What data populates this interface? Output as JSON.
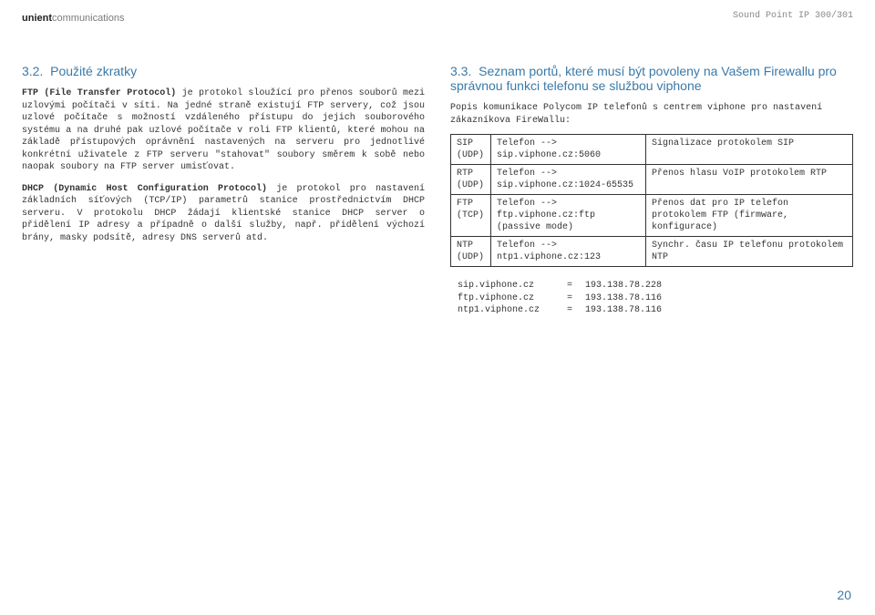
{
  "header": {
    "logo_bold": "unient",
    "logo_light": "communications",
    "device": "Sound Point IP 300/301"
  },
  "left": {
    "h_num": "3.2.",
    "h_text": "Použité zkratky",
    "p1_bold": "FTP (File Transfer Protocol)",
    "p1_rest": " je protokol sloužící pro přenos souborů mezi uzlovými počítači v síti. Na jedné straně existují FTP servery, což jsou uzlové počítače s možností vzdáleného přístupu do jejich souborového systému a na druhé pak uzlové počítače v roli FTP klientů, které mohou na základě přístupových oprávnění nastavených na serveru pro jednotlivé konkrétní uživatele z FTP serveru \"stahovat\" soubory směrem k sobě nebo naopak soubory na FTP server umisťovat.",
    "p2_bold": "DHCP (Dynamic Host Configuration Protocol)",
    "p2_rest": " je protokol pro nastavení základních síťových (TCP/IP) parametrů stanice prostřednictvím DHCP serveru. V protokolu DHCP žádají klientské stanice DHCP server o přidělení IP adresy a případně o další služby, např. přidělení výchozí brány, masky podsítě, adresy DNS serverů atd."
  },
  "right": {
    "h_num": "3.3.",
    "h_text": "Seznam portů, které musí být povoleny na Vašem Firewallu pro správnou funkci telefonu se službou viphone",
    "desc": "Popis komunikace Polycom IP telefonů s centrem viphone pro nastavení zákazníkova FireWallu:",
    "table": [
      {
        "c1": "SIP\n(UDP)",
        "c2": "Telefon -->\nsip.viphone.cz:5060",
        "c3": "Signalizace protokolem SIP"
      },
      {
        "c1": "RTP\n(UDP)",
        "c2": "Telefon -->\nsip.viphone.cz:1024-65535",
        "c3": "Přenos hlasu VoIP protokolem RTP"
      },
      {
        "c1": "FTP\n(TCP)",
        "c2": "Telefon -->\nftp.viphone.cz:ftp (passive mode)",
        "c3": "Přenos dat pro IP telefon protokolem FTP (firmware, konfigurace)"
      },
      {
        "c1": "NTP\n(UDP)",
        "c2": "Telefon -->\nntp1.viphone.cz:123",
        "c3": "Synchr. času IP telefonu protokolem NTP"
      }
    ],
    "hosts": [
      {
        "h": "sip.viphone.cz",
        "ip": "193.138.78.228"
      },
      {
        "h": "ftp.viphone.cz",
        "ip": "193.138.78.116"
      },
      {
        "h": "ntp1.viphone.cz",
        "ip": "193.138.78.116"
      }
    ]
  },
  "page_num": "20"
}
